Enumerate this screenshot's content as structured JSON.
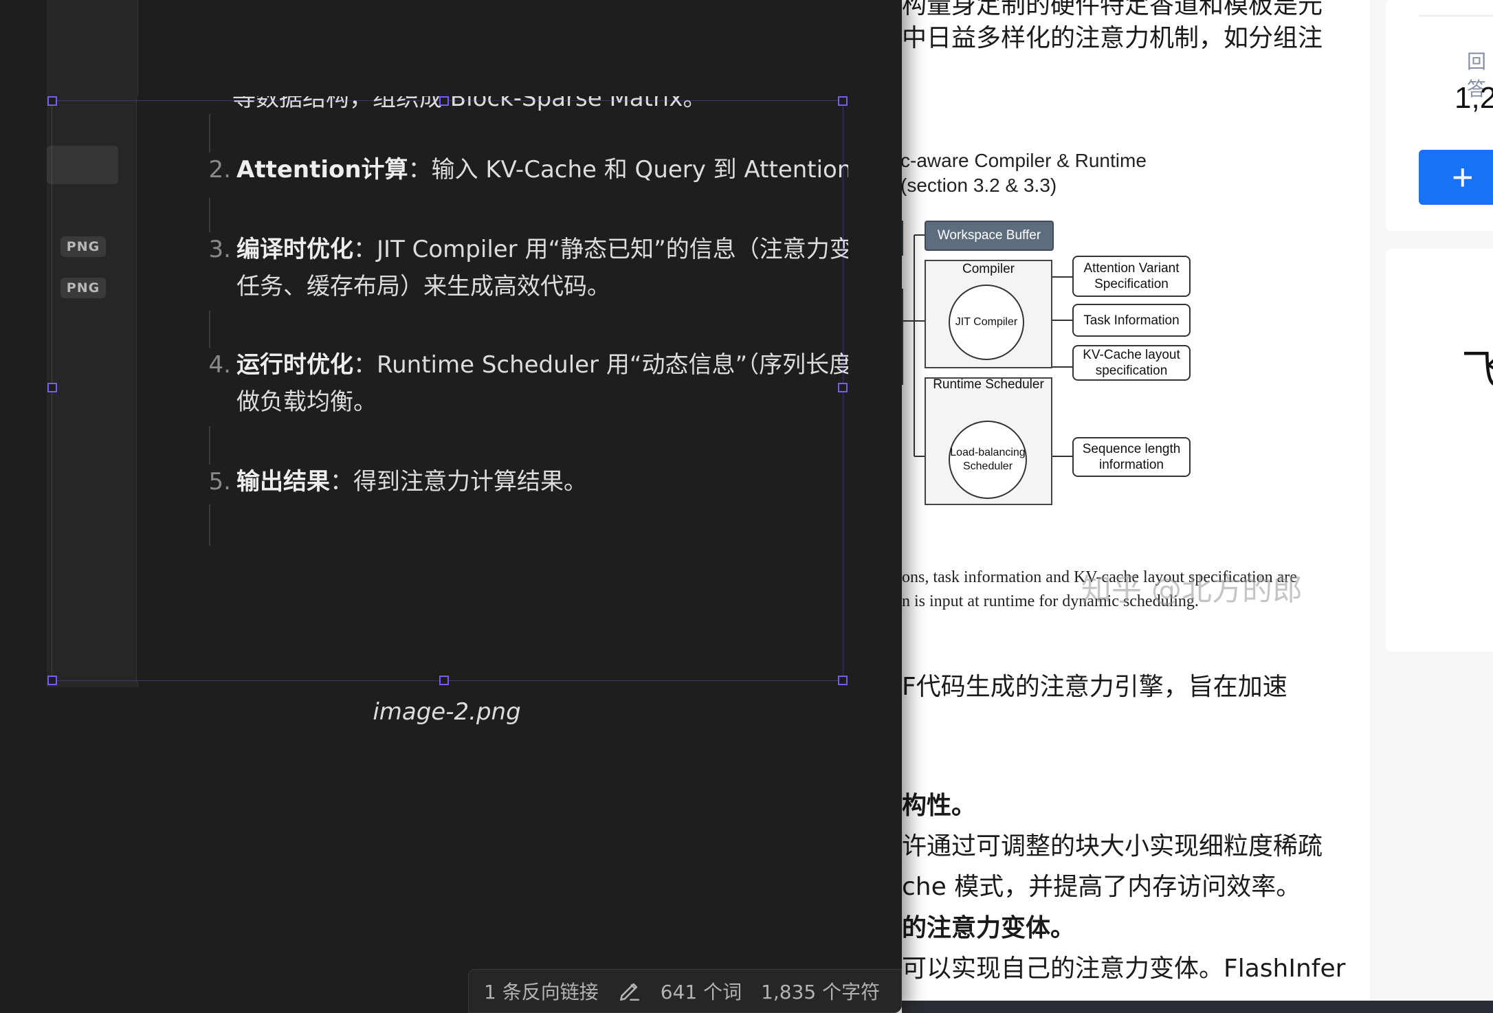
{
  "article": {
    "lines_top": [
      {
        "text": "构量身定制的硬件特定香道和模板是元"
      },
      {
        "text": "中日益多样化的注意力机制，如分组注"
      }
    ],
    "figure": {
      "title_line1": "c-aware Compiler & Runtime",
      "title_line2": " (section 3.2 & 3.3)",
      "workspace_buffer": "Workspace Buffer",
      "compiler_label": "Compiler",
      "jit_compiler": "JIT Compiler",
      "runtime_label": "Runtime Scheduler",
      "lb_scheduler": "Load-balancing Scheduler",
      "spec_attention": "Attention Variant Specification",
      "spec_task": "Task Information",
      "spec_kv": "KV-Cache layout specification",
      "spec_seq": "Sequence length information"
    },
    "caption_line1": "ons, task information and KV-cache layout specification are",
    "caption_line2": "n is input at runtime for dynamic scheduling.",
    "watermark": "知乎 @北方的郎",
    "lines_bottom": [
      {
        "text": "F代码生成的注意力引擎，旨在加速",
        "bold": false
      },
      {
        "text": "构性。",
        "bold": true
      },
      {
        "text": "许通过可调整的块大小实现细粒度稀疏",
        "bold": false
      },
      {
        "text": "che 模式，并提高了内存访问效率。",
        "bold": false
      },
      {
        "text": "的注意力变体。",
        "bold": true
      },
      {
        "text": "可以实现自己的注意力变体。FlashInfer",
        "bold": false
      }
    ]
  },
  "sidebar": {
    "answer_label": "回答",
    "answer_count": "1,2",
    "add_button_icon": "plus-icon",
    "glyph": "飞"
  },
  "editor": {
    "cut_top_text": "等数据结构，组织成 Block-Sparse Matrix。",
    "file_badges": [
      "PNG",
      "PNG"
    ],
    "list": [
      {
        "num": "2.",
        "strong": "Attention计算",
        "rest": "：输入 KV-Cache 和 Query 到 Attention K",
        "cont": ""
      },
      {
        "num": "3.",
        "strong": "编译时优化",
        "rest": "：JIT Compiler 用“静态已知”的信息（注意力变",
        "cont": "任务、缓存布局）来生成高效代码。"
      },
      {
        "num": "4.",
        "strong": "运行时优化",
        "rest": "：Runtime Scheduler 用“动态信息”（序列长度",
        "cont": "做负载均衡。"
      },
      {
        "num": "5.",
        "strong": "输出结果",
        "rest": "：得到注意力计算结果。",
        "cont": ""
      }
    ],
    "image_caption": "image-2.png"
  },
  "status_bar": {
    "backlinks": "1 条反向链接",
    "words": "641 个词",
    "chars": "1,835 个字符",
    "edit_icon": "pencil-icon"
  },
  "colors": {
    "accent_handle": "#7a5af5",
    "editor_bg": "#1e1e1e",
    "primary_button": "#1772f6"
  }
}
